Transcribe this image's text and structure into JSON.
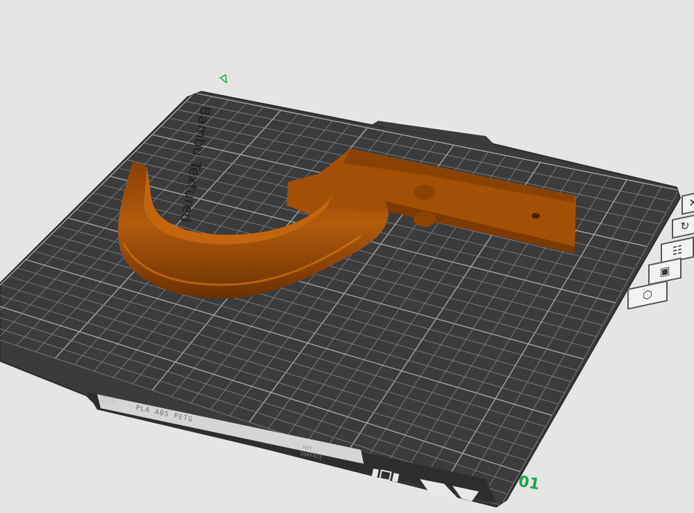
{
  "viewport": {
    "background": "#e5e5e3",
    "plate_color": "#3a3b3c",
    "grid_color": "#8e8f91",
    "model_color": "#9a4a05",
    "accent_green": "#15a84a"
  },
  "build_plate": {
    "brand_text": "Bambu Textured PEI Plate",
    "material_text": "PLA ABS PETG",
    "hot_surface_line1": "HOT",
    "hot_surface_line2": "SURFACE",
    "plate_number": "01",
    "corner_marker": "∇"
  },
  "plate_toolbar": {
    "buttons": [
      {
        "icon": "close-icon",
        "label": "✕"
      },
      {
        "icon": "auto-orient-icon",
        "label": "↻"
      },
      {
        "icon": "arrange-icon",
        "label": "☷"
      },
      {
        "icon": "lock-icon",
        "label": "▣"
      },
      {
        "icon": "settings-icon",
        "label": "⬡"
      }
    ]
  }
}
